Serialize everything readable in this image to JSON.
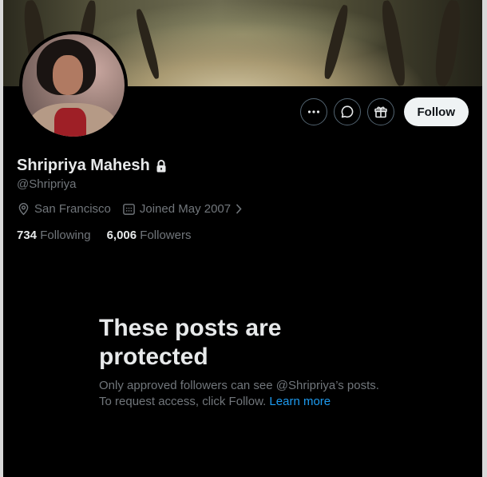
{
  "profile": {
    "name": "Shripriya Mahesh",
    "handle": "@Shripriya",
    "location": "San Francisco",
    "joined": "Joined May 2007",
    "following_count": "734",
    "following_label": "Following",
    "followers_count": "6,006",
    "followers_label": "Followers"
  },
  "actions": {
    "more_icon": "more-icon",
    "message_icon": "message-icon",
    "gift_icon": "gift-icon",
    "follow_label": "Follow"
  },
  "protected": {
    "headline_line1": "These posts are",
    "headline_line2": "protected",
    "desc_line1": "Only approved followers can see @Shripriya’s posts.",
    "desc_line2": "To request access, click Follow.",
    "learn_more": "Learn more"
  },
  "colors": {
    "background": "#000000",
    "text_primary": "#e7e9ea",
    "text_secondary": "#71767b",
    "link": "#1d9bf0",
    "follow_button": "#eff3f4"
  }
}
